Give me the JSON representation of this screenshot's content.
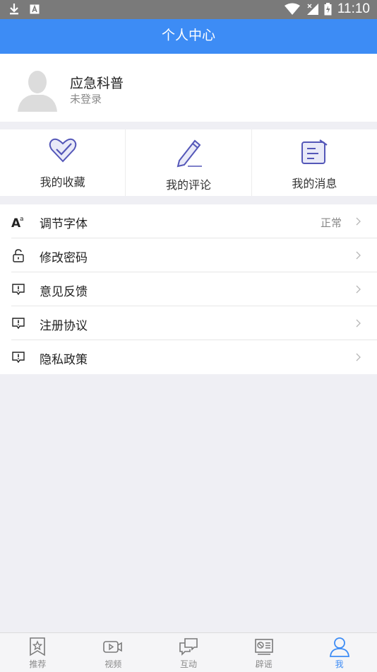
{
  "status_bar": {
    "time": "11:10"
  },
  "header": {
    "title": "个人中心"
  },
  "profile": {
    "name": "应急科普",
    "login_status": "未登录"
  },
  "quick_actions": [
    {
      "label": "我的收藏",
      "icon": "heart-icon"
    },
    {
      "label": "我的评论",
      "icon": "pen-icon"
    },
    {
      "label": "我的消息",
      "icon": "message-icon"
    }
  ],
  "settings": [
    {
      "label": "调节字体",
      "value": "正常",
      "icon": "font-size-icon"
    },
    {
      "label": "修改密码",
      "icon": "lock-icon"
    },
    {
      "label": "意见反馈",
      "icon": "feedback-icon"
    },
    {
      "label": "注册协议",
      "icon": "feedback-icon"
    },
    {
      "label": "隐私政策",
      "icon": "feedback-icon"
    }
  ],
  "tabs": [
    {
      "label": "推荐",
      "icon": "star-bookmark-icon",
      "active": false
    },
    {
      "label": "视频",
      "icon": "video-icon",
      "active": false
    },
    {
      "label": "互动",
      "icon": "chat-icon",
      "active": false
    },
    {
      "label": "辟谣",
      "icon": "news-icon",
      "active": false
    },
    {
      "label": "我",
      "icon": "person-icon",
      "active": true
    }
  ],
  "colors": {
    "primary": "#3d8cf5",
    "background": "#efeff4",
    "icon_purple": "#5457b8"
  }
}
